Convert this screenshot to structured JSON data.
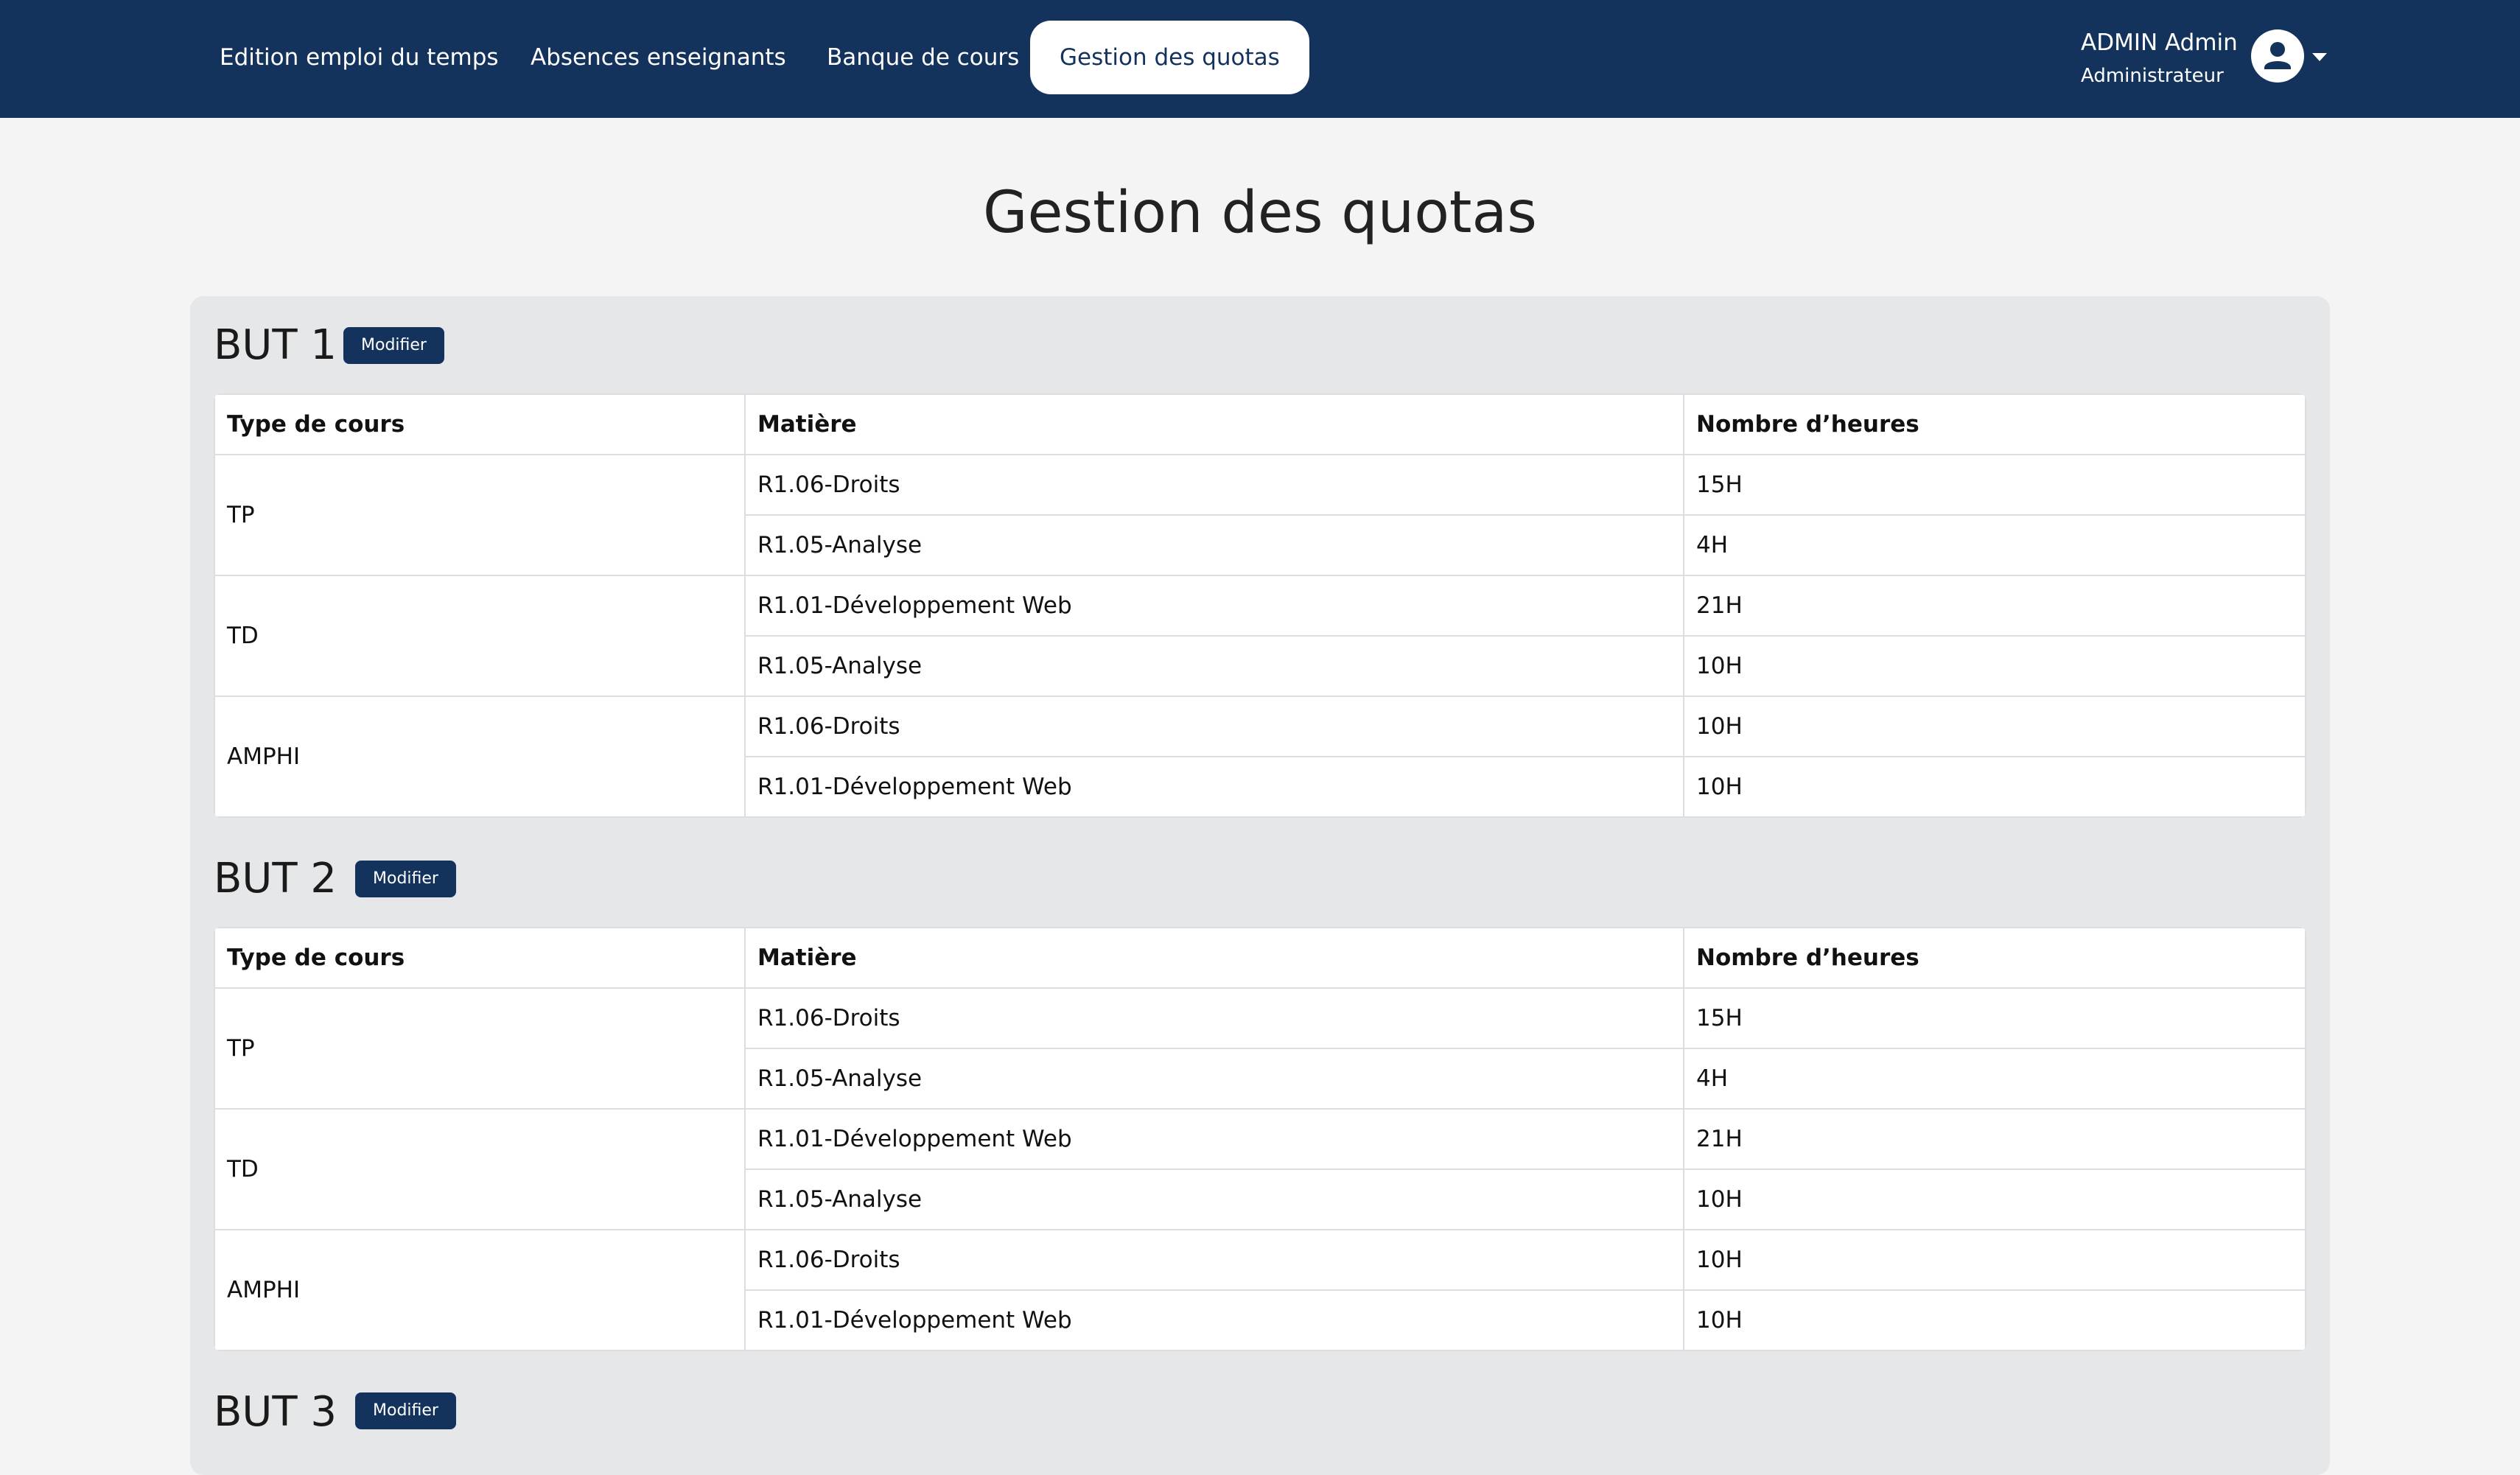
{
  "nav": {
    "items": [
      {
        "label": "Edition emploi du temps",
        "active": false
      },
      {
        "label": "Absences enseignants",
        "active": false
      },
      {
        "label": "Banque de cours",
        "active": false
      },
      {
        "label": "Gestion des quotas",
        "active": true
      }
    ],
    "user": {
      "name": "ADMIN Admin",
      "role": "Administrateur"
    }
  },
  "page": {
    "title": "Gestion des quotas"
  },
  "table_headers": [
    "Type de cours",
    "Matière",
    "Nombre d’heures"
  ],
  "sections": [
    {
      "title": "BUT 1",
      "modify_label": "Modifier",
      "groups": [
        {
          "type": "TP",
          "rows": [
            {
              "matiere": "R1.06-Droits",
              "heures": "15H"
            },
            {
              "matiere": "R1.05-Analyse",
              "heures": "4H"
            }
          ]
        },
        {
          "type": "TD",
          "rows": [
            {
              "matiere": "R1.01-Développement Web",
              "heures": "21H"
            },
            {
              "matiere": "R1.05-Analyse",
              "heures": "10H"
            }
          ]
        },
        {
          "type": "AMPHI",
          "rows": [
            {
              "matiere": "R1.06-Droits",
              "heures": "10H"
            },
            {
              "matiere": "R1.01-Développement Web",
              "heures": "10H"
            }
          ]
        }
      ]
    },
    {
      "title": "BUT 2",
      "modify_label": "Modifier",
      "groups": [
        {
          "type": "TP",
          "rows": [
            {
              "matiere": "R1.06-Droits",
              "heures": "15H"
            },
            {
              "matiere": "R1.05-Analyse",
              "heures": "4H"
            }
          ]
        },
        {
          "type": "TD",
          "rows": [
            {
              "matiere": "R1.01-Développement Web",
              "heures": "21H"
            },
            {
              "matiere": "R1.05-Analyse",
              "heures": "10H"
            }
          ]
        },
        {
          "type": "AMPHI",
          "rows": [
            {
              "matiere": "R1.06-Droits",
              "heures": "10H"
            },
            {
              "matiere": "R1.01-Développement Web",
              "heures": "10H"
            }
          ]
        }
      ]
    },
    {
      "title": "BUT 3",
      "modify_label": "Modifier",
      "groups": []
    }
  ],
  "icons": {
    "avatar": "user-circle-icon",
    "caret": "caret-down-icon"
  },
  "colors": {
    "navbar": "#13325c",
    "panel": "#e6e7e9",
    "background": "#f4f4f4",
    "button": "#13325c"
  }
}
